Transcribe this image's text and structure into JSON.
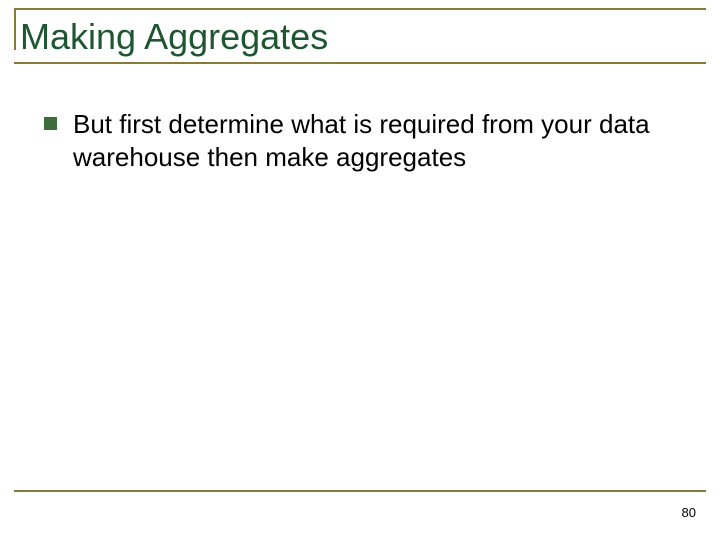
{
  "title": "Making Aggregates",
  "bullets": [
    {
      "text": "But first determine what is required from your data warehouse then make aggregates"
    }
  ],
  "page_number": "80",
  "colors": {
    "accent_line": "#8a7a3a",
    "title_color": "#1e5631",
    "bullet_color": "#3b6e3b"
  }
}
